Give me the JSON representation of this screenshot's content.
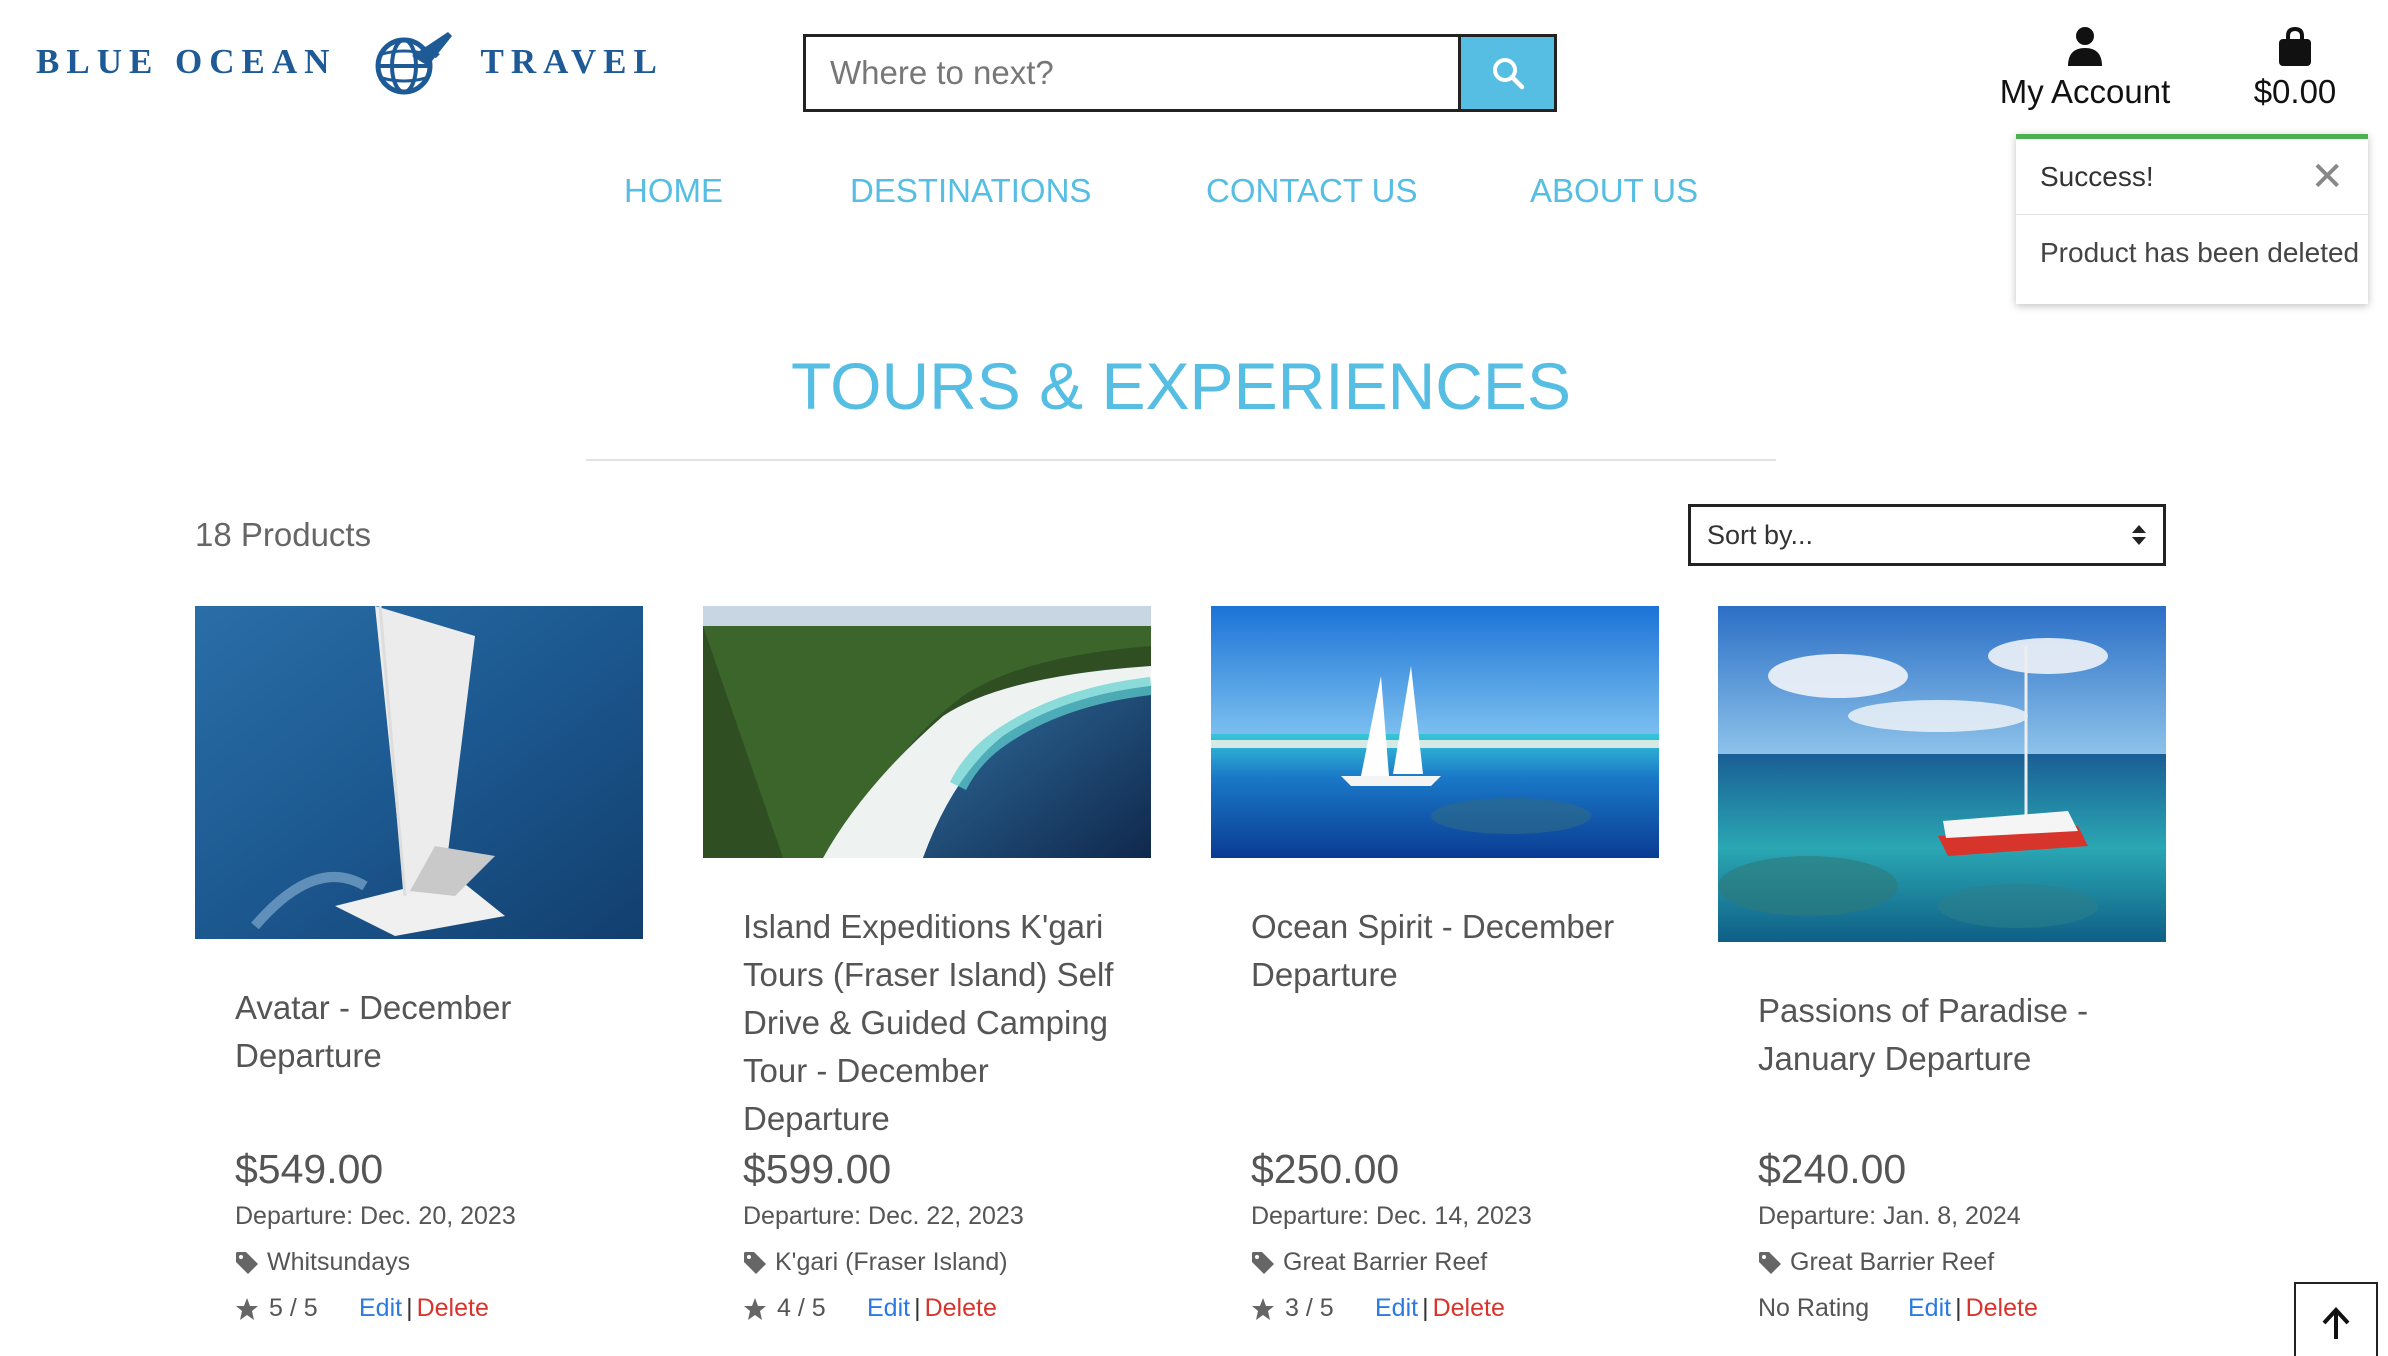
{
  "brand": {
    "left": "BLUE OCEAN",
    "right": "TRAVEL"
  },
  "search": {
    "placeholder": "Where to next?"
  },
  "header": {
    "account_label": "My Account",
    "bag_total": "$0.00"
  },
  "nav": [
    "HOME",
    "DESTINATIONS",
    "CONTACT US",
    "ABOUT US"
  ],
  "toast": {
    "title": "Success!",
    "message": "Product has been deleted"
  },
  "page": {
    "title": "TOURS & EXPERIENCES",
    "count": "18 Products",
    "sort_label": "Sort by..."
  },
  "products": [
    {
      "title": "Avatar - December Departure",
      "price": "$549.00",
      "departure": "Departure: Dec. 20, 2023",
      "location": "Whitsundays",
      "rating": "5 / 5",
      "edit": "Edit",
      "delete": "Delete"
    },
    {
      "title": "Island Expeditions K'gari Tours (Fraser Island) Self Drive & Guided Camping Tour - December Departure",
      "price": "$599.00",
      "departure": "Departure: Dec. 22, 2023",
      "location": "K'gari (Fraser Island)",
      "rating": "4 / 5",
      "edit": "Edit",
      "delete": "Delete"
    },
    {
      "title": "Ocean Spirit - December Departure",
      "price": "$250.00",
      "departure": "Departure: Dec. 14, 2023",
      "location": "Great Barrier Reef",
      "rating": "3 / 5",
      "edit": "Edit",
      "delete": "Delete"
    },
    {
      "title": "Passions of Paradise - January Departure",
      "price": "$240.00",
      "departure": "Departure: Jan. 8, 2024",
      "location": "Great Barrier Reef",
      "rating": "No Rating",
      "edit": "Edit",
      "delete": "Delete"
    }
  ],
  "colors": {
    "accent": "#56bde3",
    "brand": "#1d5a96",
    "success": "#4caf50",
    "edit": "#2a7ae2",
    "delete": "#d9342b"
  }
}
